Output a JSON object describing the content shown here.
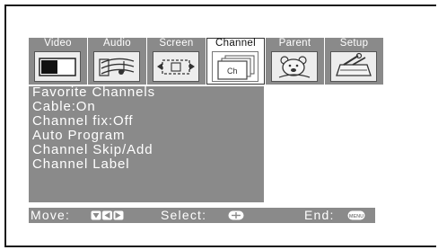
{
  "tabs": [
    {
      "label": "Video",
      "icon": "video-icon",
      "active": false
    },
    {
      "label": "Audio",
      "icon": "audio-icon",
      "active": false
    },
    {
      "label": "Screen",
      "icon": "screen-icon",
      "active": false
    },
    {
      "label": "Channel",
      "icon": "channel-icon",
      "active": true,
      "icon_text": "Ch"
    },
    {
      "label": "Parent",
      "icon": "parent-icon",
      "active": false
    },
    {
      "label": "Setup",
      "icon": "setup-icon",
      "active": false
    }
  ],
  "menu": {
    "items": [
      "Favorite Channels",
      "Cable:On",
      "Channel fix:Off",
      "Auto Program",
      "Channel Skip/Add",
      "Channel Label"
    ]
  },
  "status": {
    "move_label": "Move:",
    "move_icon": "arrow-keys-icon",
    "select_label": "Select:",
    "select_icon": "select-button-icon",
    "end_label": "End:",
    "end_icon": "menu-button-icon",
    "end_icon_text": "MENU"
  },
  "colors": {
    "panel_gray": "#8a8a8a",
    "text_white": "#ffffff",
    "border_dark": "#1a1a1a"
  }
}
